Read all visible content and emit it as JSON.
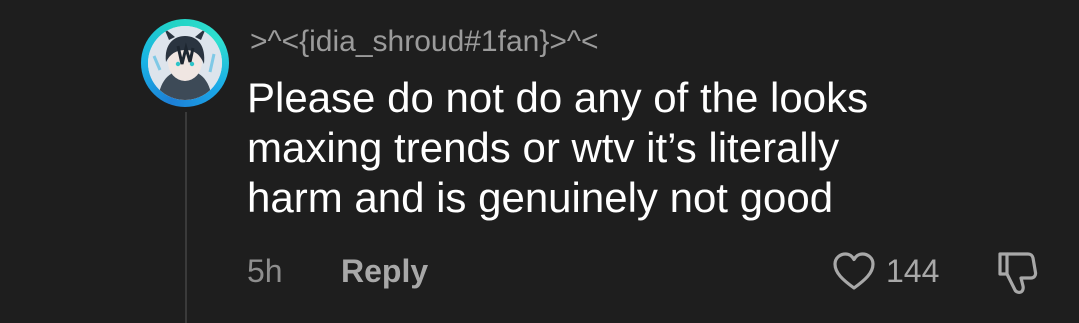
{
  "comment": {
    "username": ">^<{idia_shroud#1fan}>^<",
    "text": "Please do not do any of the looks\nmaxing trends or wtv it’s literally\nharm and is genuinely not good",
    "time": "5h",
    "reply_label": "Reply",
    "like_count": "144",
    "avatar_ring_colors": [
      "#1d7fd6",
      "#22d3c5"
    ]
  },
  "icons": {
    "like": "heart-outline-icon",
    "dislike": "thumbs-down-outline-icon"
  }
}
